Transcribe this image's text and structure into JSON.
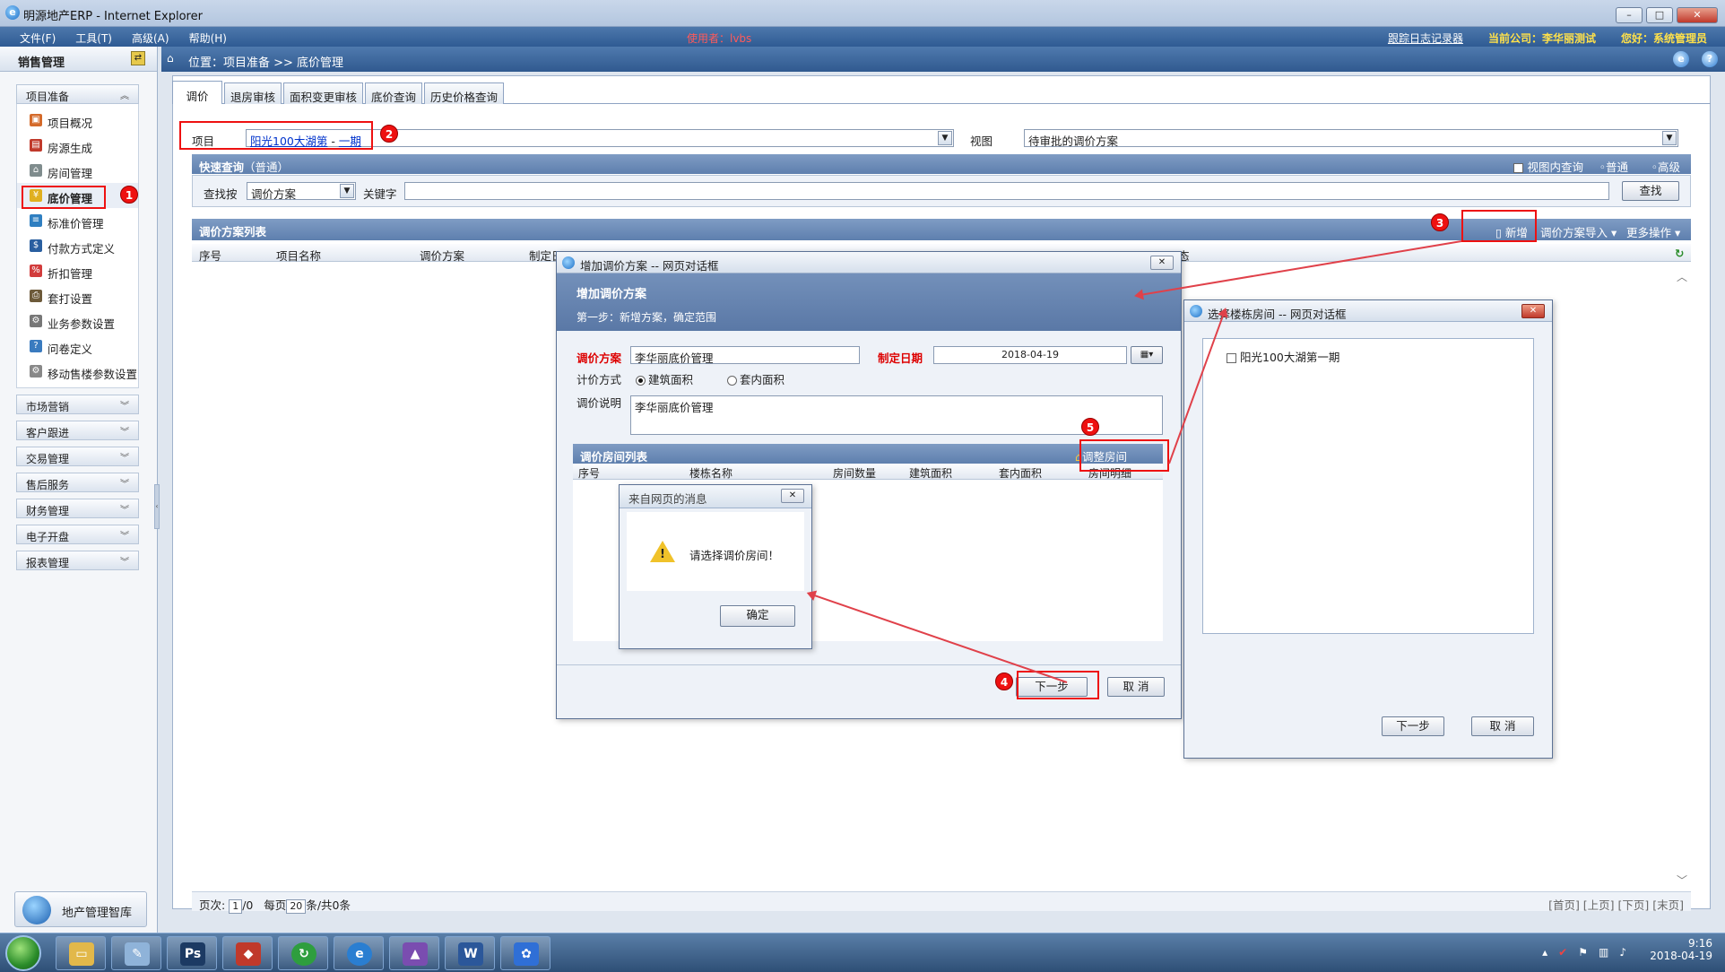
{
  "window": {
    "title": "明源地产ERP - Internet Explorer",
    "ie_icon": "ie-icon"
  },
  "menubar": {
    "items": [
      "文件(F)",
      "工具(T)",
      "高级(A)",
      "帮助(H)"
    ],
    "user_info": "使用者：lvbs",
    "right": {
      "log": "跟踪日志记录器",
      "company": "当前公司：李华丽测试",
      "greeting": "您好：系统管理员"
    }
  },
  "sidebar": {
    "title": "销售管理",
    "groups": [
      {
        "label": "项目准备",
        "expanded": true,
        "items": [
          "项目概况",
          "房源生成",
          "房间管理",
          "底价管理",
          "标准价管理",
          "付款方式定义",
          "折扣管理",
          "套打设置",
          "业务参数设置",
          "问卷定义",
          "移动售楼参数设置"
        ]
      },
      {
        "label": "市场营销"
      },
      {
        "label": "客户跟进"
      },
      {
        "label": "交易管理"
      },
      {
        "label": "售后服务"
      },
      {
        "label": "财务管理"
      },
      {
        "label": "电子开盘"
      },
      {
        "label": "报表管理"
      }
    ],
    "footer": "地产管理智库"
  },
  "breadcrumb": {
    "text": "位置：项目准备 >> 底价管理"
  },
  "tabs": [
    "调价",
    "退房审核",
    "面积变更审核",
    "底价查询",
    "历史价格查询"
  ],
  "project": {
    "label": "项目",
    "value_a": "阳光100大湖第",
    "sep": " - ",
    "value_b": "一期",
    "view_label": "视图",
    "view_value": "待审批的调价方案"
  },
  "quick_search": {
    "title": "快速查询",
    "mode": "（普通）",
    "in_view": "视图内查询",
    "normal": "普通",
    "advanced": "高级",
    "find_by_label": "查找按",
    "find_by_value": "调价方案",
    "keyword_label": "关键字",
    "keyword_value": "",
    "search_btn": "查找"
  },
  "plan_list": {
    "title": "调价方案列表",
    "new_btn": "新增",
    "import_btn": "调价方案导入",
    "more_btn": "更多操作",
    "columns": [
      "序号",
      "项目名称",
      "调价方案",
      "制定日",
      "态"
    ]
  },
  "pager": {
    "page_label": "页次:",
    "page_value": "1",
    "page_total": "/0",
    "per_label": "每页",
    "per_value": "20",
    "per_suffix": "条/共0条",
    "nav": "[首页] [上页] [下页] [末页]"
  },
  "dialog_add": {
    "title": "增加调价方案 -- 网页对话框",
    "banner_title": "增加调价方案",
    "banner_step": "第一步：新增方案，确定范围",
    "plan_label": "调价方案",
    "plan_value": "李华丽底价管理",
    "date_label": "制定日期",
    "date_value": "2018-04-19",
    "calc_label": "计价方式",
    "calc_opt1": "建筑面积",
    "calc_opt2": "套内面积",
    "desc_label": "调价说明",
    "desc_value": "李华丽底价管理",
    "room_list_title": "调价房间列表",
    "adjust_btn": "调整房间",
    "room_columns": [
      "序号",
      "楼栋名称",
      "房间数量",
      "建筑面积",
      "套内面积",
      "房间明细"
    ],
    "next_btn": "下一步",
    "cancel_btn": "取 消"
  },
  "dialog_msg": {
    "title": "来自网页的消息",
    "message": "请选择调价房间！",
    "ok_btn": "确定"
  },
  "dialog_select": {
    "title": "选择楼栋房间 -- 网页对话框",
    "tree_item": "阳光100大湖第一期",
    "next_btn": "下一步",
    "cancel_btn": "取 消"
  },
  "annotations": [
    "1",
    "2",
    "3",
    "4",
    "5"
  ],
  "colors": {
    "accent_bar": "#30598f",
    "annotation_red": "#e11111",
    "panel_header": "#5e7fae"
  },
  "taskbar": {
    "time": "9:16",
    "date": "2018-04-19"
  }
}
